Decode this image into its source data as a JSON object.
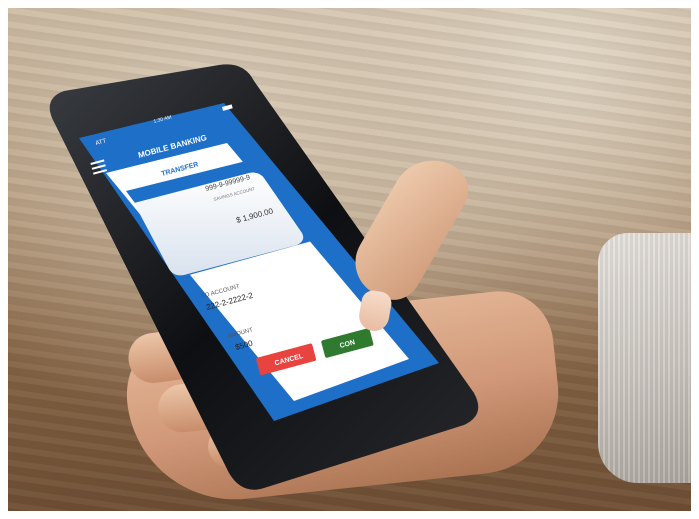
{
  "status_bar": {
    "carrier": "ATT",
    "time": "1:30 AM"
  },
  "app": {
    "title": "MOBILE BANKING",
    "screen": "TRANSFER"
  },
  "from_account": {
    "number": "999-9-99999-9",
    "type": "SAVINGS ACCOUNT",
    "balance": "$ 1,900.00"
  },
  "to_account": {
    "label": "TO ACCOUNT",
    "value": "222-2-2222-2"
  },
  "amount": {
    "label": "AMOUNT",
    "value": "$500"
  },
  "buttons": {
    "cancel": "CANCEL",
    "confirm": "CON"
  },
  "colors": {
    "primary_blue": "#1e6fc8",
    "cancel_red": "#e8433f",
    "confirm_green": "#2f7a2f"
  },
  "icons": {
    "menu": "hamburger-icon",
    "battery": "battery-icon"
  }
}
